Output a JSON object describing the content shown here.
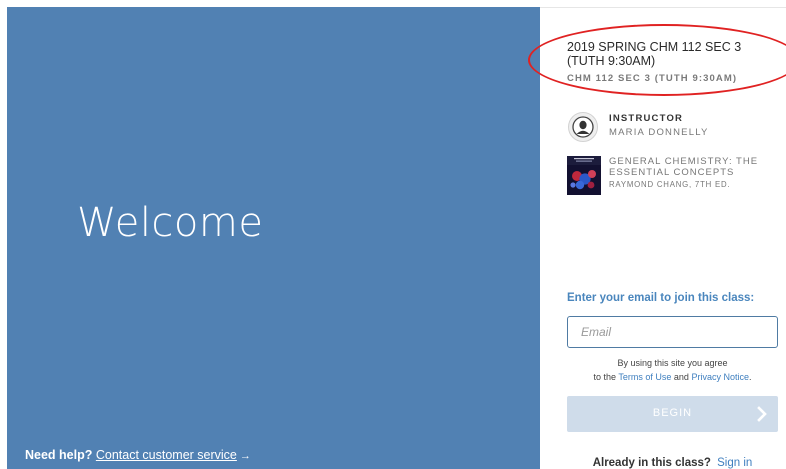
{
  "welcome_panel": {
    "heading": "Welcome",
    "help_prefix": "Need help?",
    "help_link": "Contact customer service",
    "help_arrow": "→"
  },
  "class_info": {
    "title": "2019 SPRING CHM 112 SEC 3 (TUTH 9:30AM)",
    "section": "CHM 112 SEC 3 (TUTH 9:30AM)"
  },
  "instructor": {
    "label": "INSTRUCTOR",
    "name": "MARIA DONNELLY"
  },
  "textbook": {
    "title": "GENERAL CHEMISTRY: THE ESSENTIAL CONCEPTS",
    "author": "RAYMOND CHANG, 7TH ED."
  },
  "join_form": {
    "label": "Enter your email to join this class:",
    "email_value": "",
    "email_placeholder": "Email",
    "terms_line1": "By using this site you agree",
    "terms_to_the": "to the",
    "terms_of_use": "Terms of Use",
    "terms_and": "and",
    "privacy_notice": "Privacy Notice",
    "terms_period": ".",
    "begin_label": "BEGIN"
  },
  "already": {
    "text": "Already in this class?",
    "sign_in": "Sign in"
  },
  "colors": {
    "panel_blue": "#5181b3",
    "accent_blue": "#4a86bd",
    "link_blue": "#3f7fbf",
    "button_disabled": "#cfdcea",
    "annotation_red": "#e02222"
  },
  "icons": {
    "avatar": "user-silhouette-icon",
    "begin": "chevron-right-icon"
  }
}
